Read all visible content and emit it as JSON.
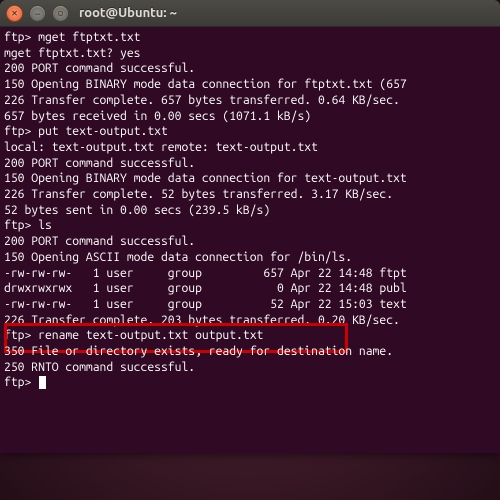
{
  "window": {
    "title": "root@Ubuntu: ~"
  },
  "terminal": {
    "lines": [
      "ftp> mget ftptxt.txt",
      "mget ftptxt.txt? yes",
      "200 PORT command successful.",
      "150 Opening BINARY mode data connection for ftptxt.txt (657",
      "226 Transfer complete. 657 bytes transferred. 0.64 KB/sec.",
      "657 bytes received in 0.00 secs (1071.1 kB/s)",
      "ftp> put text-output.txt",
      "local: text-output.txt remote: text-output.txt",
      "200 PORT command successful.",
      "150 Opening BINARY mode data connection for text-output.txt",
      "226 Transfer complete. 52 bytes transferred. 3.17 KB/sec.",
      "52 bytes sent in 0.00 secs (239.5 kB/s)",
      "ftp> ls",
      "200 PORT command successful.",
      "150 Opening ASCII mode data connection for /bin/ls.",
      "-rw-rw-rw-   1 user     group         657 Apr 22 14:48 ftpt",
      "drwxrwxrwx   1 user     group           0 Apr 22 14:48 publ",
      "-rw-rw-rw-   1 user     group          52 Apr 22 15:03 text",
      "226 Transfer complete. 203 bytes transferred. 0.20 KB/sec.",
      "ftp> rename text-output.txt output.txt",
      "350 File or directory exists, ready for destination name.",
      "250 RNTO command successful.",
      "ftp> "
    ],
    "highlight_index": 19
  }
}
